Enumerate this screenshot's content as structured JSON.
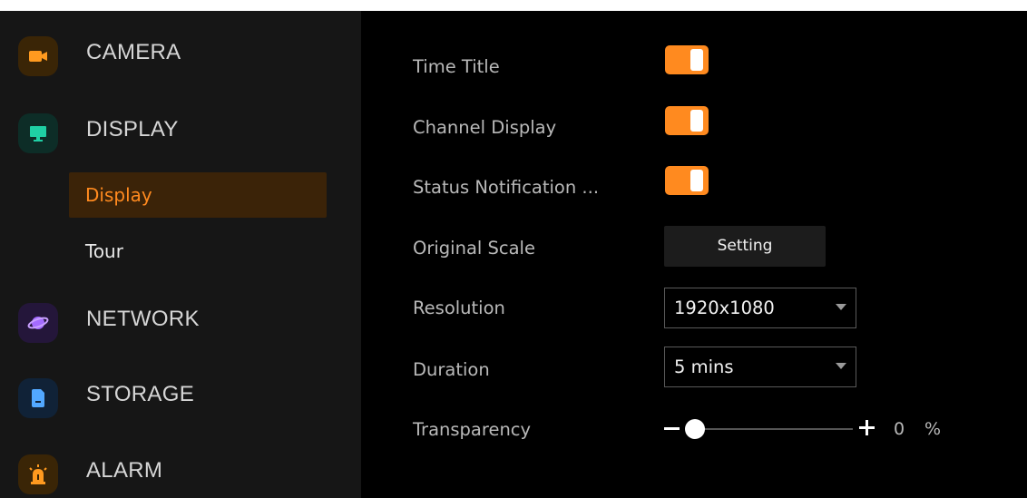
{
  "sidebar": {
    "categories": [
      {
        "label": "CAMERA",
        "icon": "camera-icon",
        "color": "#ff9a1f",
        "bg": "#3a2506"
      },
      {
        "label": "DISPLAY",
        "icon": "monitor-icon",
        "color": "#1fcfa4",
        "bg": "#0d2d27"
      },
      {
        "label": "NETWORK",
        "icon": "planet-icon",
        "color": "#a46bff",
        "bg": "#24163a"
      },
      {
        "label": "STORAGE",
        "icon": "storage-icon",
        "color": "#52a8ff",
        "bg": "#102237"
      },
      {
        "label": "ALARM",
        "icon": "alarm-icon",
        "color": "#ff9a1f",
        "bg": "#3a2506"
      }
    ],
    "display_subitems": [
      {
        "label": "Display",
        "active": true
      },
      {
        "label": "Tour",
        "active": false
      }
    ]
  },
  "main": {
    "time_title": {
      "label": "Time Title",
      "enabled": true
    },
    "channel_display": {
      "label": "Channel Display",
      "enabled": true
    },
    "status_notification": {
      "label": "Status Notification ...",
      "enabled": true
    },
    "original_scale": {
      "label": "Original Scale",
      "button_label": "Setting"
    },
    "resolution": {
      "label": "Resolution",
      "value": "1920x1080"
    },
    "duration": {
      "label": "Duration",
      "value": "5 mins"
    },
    "transparency": {
      "label": "Transparency",
      "value": "0",
      "unit": "%",
      "level": 0
    }
  },
  "colors": {
    "accent": "#ff8a1f",
    "sidebar_bg": "#161616",
    "main_bg": "#000000",
    "active_bg": "#3b2308"
  }
}
